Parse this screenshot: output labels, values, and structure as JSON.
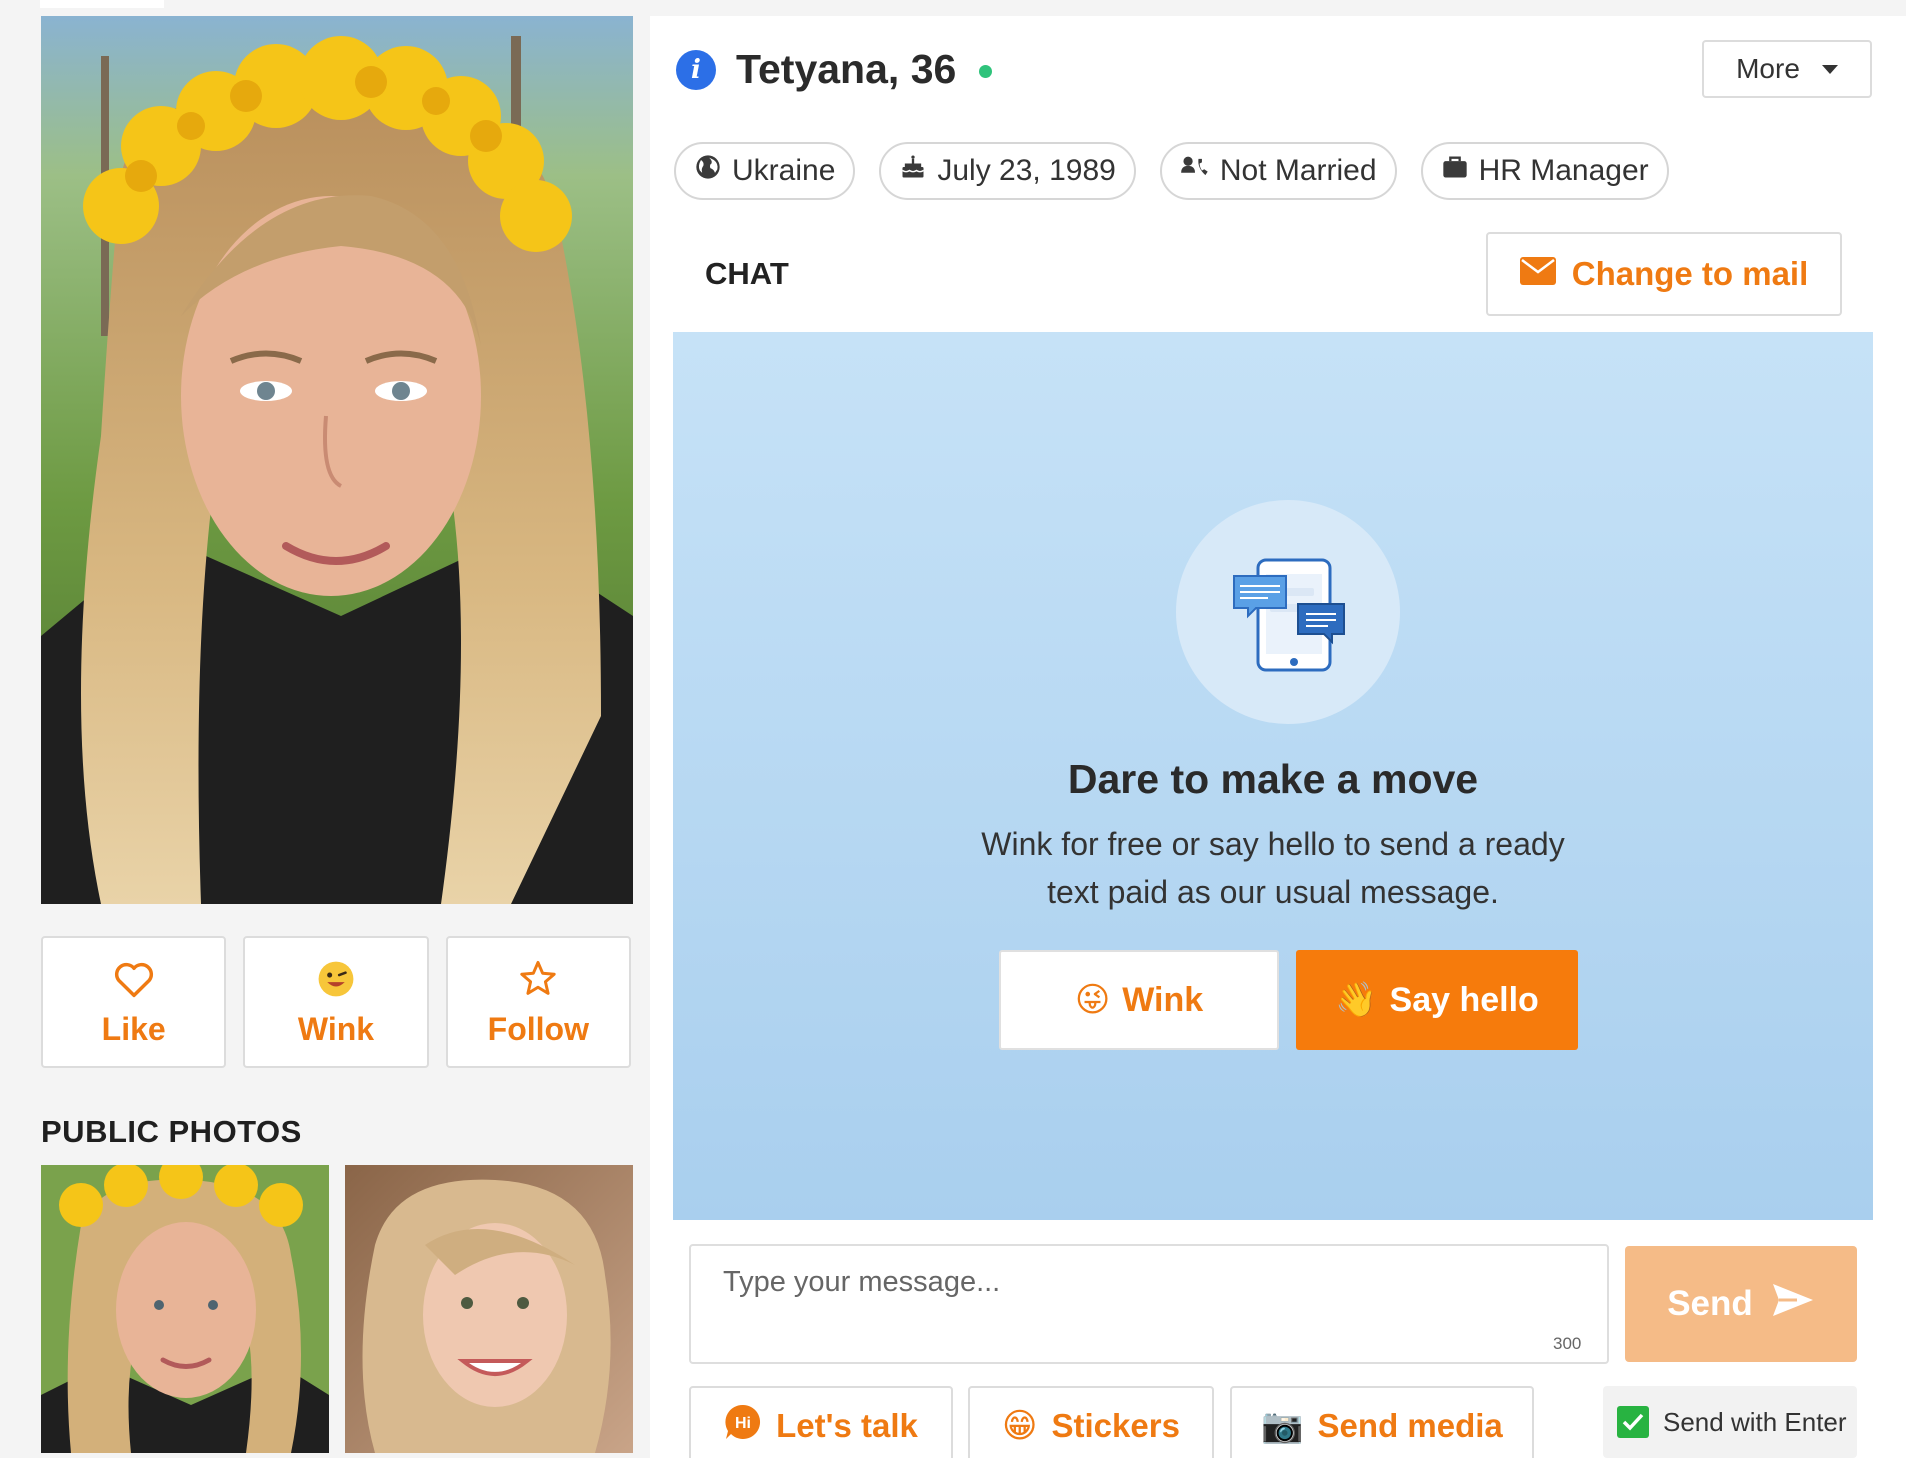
{
  "profile": {
    "name": "Tetyana, 36",
    "online_color": "#2fc37b",
    "country": "Ukraine",
    "birthday": "July 23, 1989",
    "marital_status": "Not Married",
    "occupation": "HR Manager"
  },
  "header": {
    "more_label": "More"
  },
  "actions": {
    "like_label": "Like",
    "wink_label": "Wink",
    "follow_label": "Follow"
  },
  "photos": {
    "section_title": "PUBLIC PHOTOS"
  },
  "chat": {
    "header_label": "CHAT",
    "change_to_mail_label": "Change to mail",
    "empty_title": "Dare to make a move",
    "empty_text": "Wink for free or say hello to send a ready text paid as our usual message.",
    "wink_label": "Wink",
    "wink_emoji": "😜",
    "say_hello_label": "Say hello",
    "say_hello_emoji": "👋",
    "input_placeholder": "Type your message...",
    "char_counter": "300",
    "send_label": "Send",
    "lets_talk_label": "Let's talk",
    "lets_talk_badge": "Hi",
    "stickers_label": "Stickers",
    "stickers_emoji": "😁",
    "send_media_label": "Send media",
    "send_media_emoji": "📷",
    "send_with_enter_label": "Send with Enter",
    "send_with_enter_checked": true
  },
  "colors": {
    "accent": "#ef7a12",
    "say_hello_bg": "#f67b0c",
    "send_bg": "#f5bb87",
    "info_icon": "#2c6fe7",
    "checkbox": "#28b341"
  },
  "icons": {
    "info": "info-icon",
    "country": "globe-icon",
    "birthday": "cake-icon",
    "marital": "contact-phone-icon",
    "occupation": "briefcase-icon",
    "like": "heart-outline-icon",
    "wink": "wink-emoji-icon",
    "follow": "star-outline-icon",
    "mail": "envelope-icon",
    "illustration": "phone-chat-icon",
    "send": "paper-plane-icon",
    "check": "checkmark-icon"
  }
}
